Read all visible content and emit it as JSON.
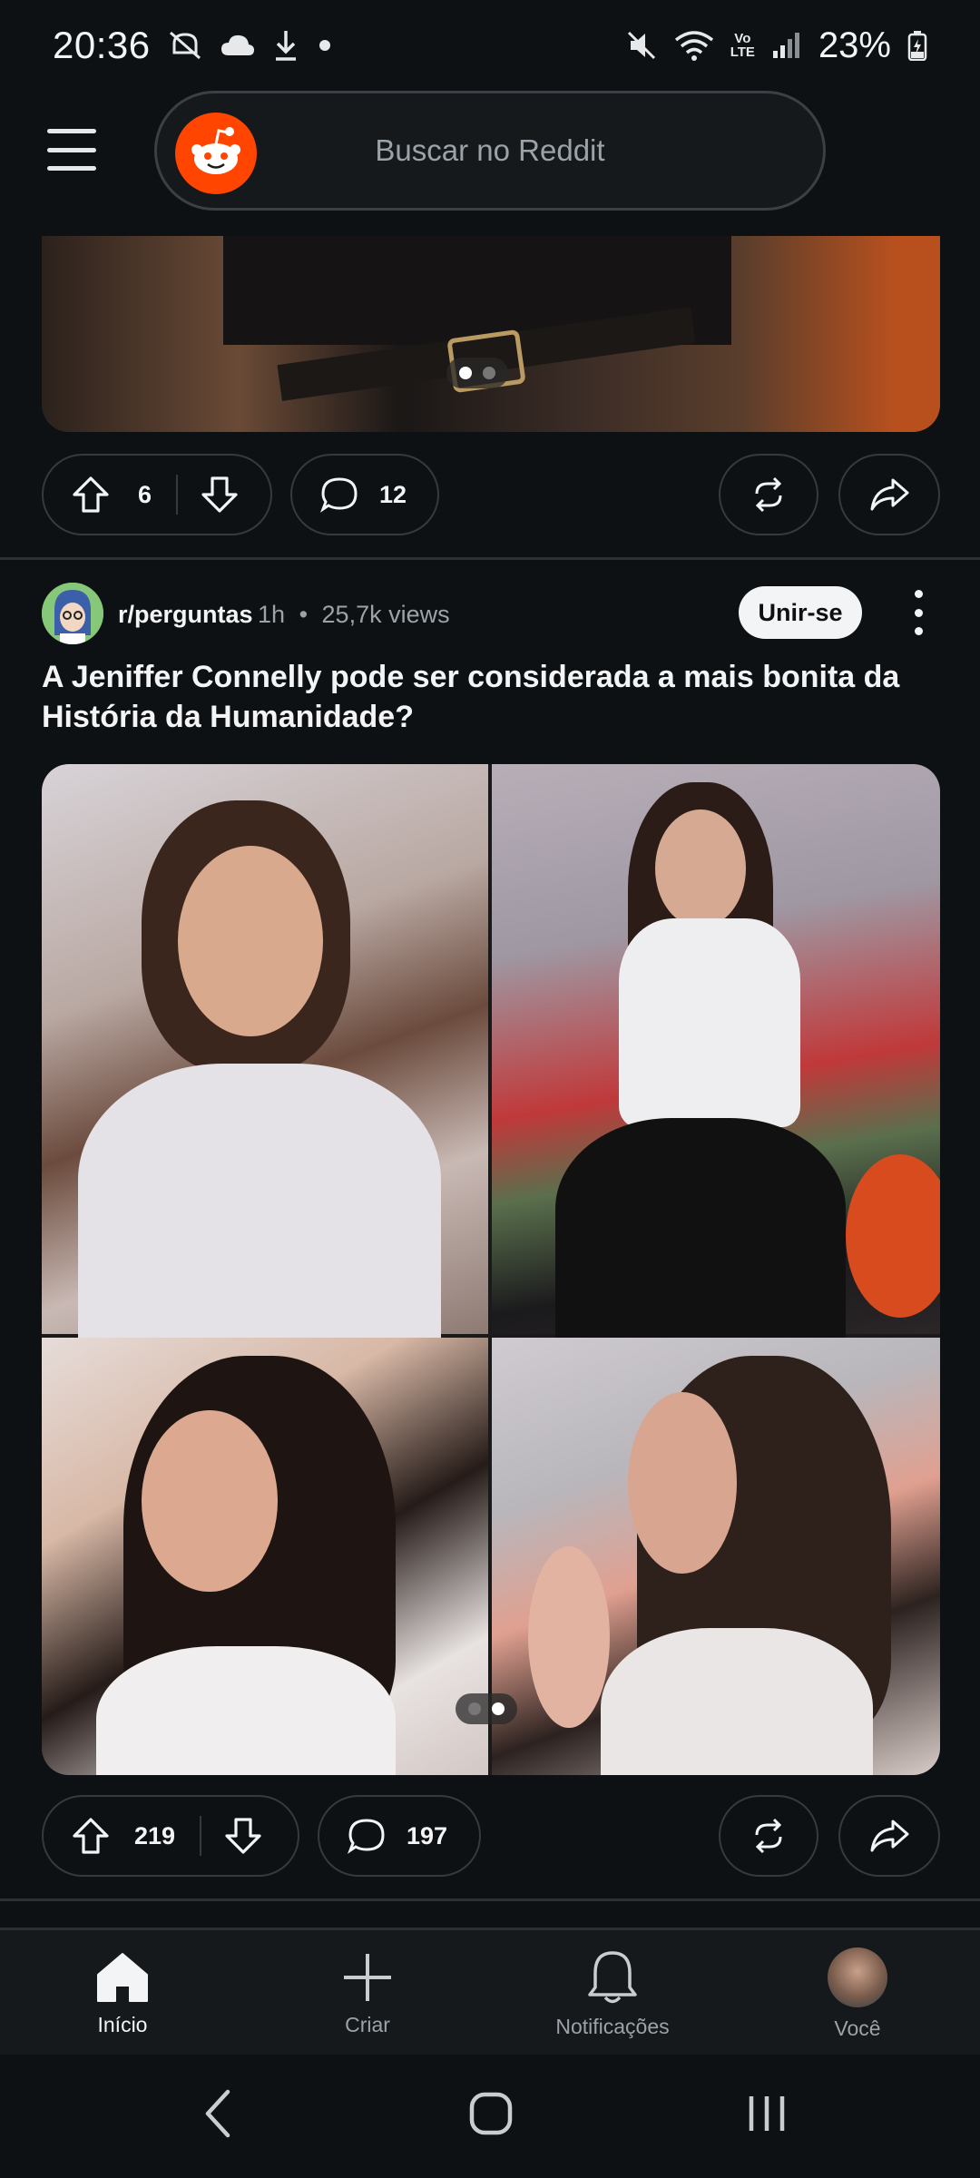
{
  "status_bar": {
    "time": "20:36",
    "left_icons": [
      "do-not-disturb-off-icon",
      "cloud-icon",
      "download-icon",
      "dot-icon"
    ],
    "right_icons": [
      "mute-icon",
      "wifi-icon",
      "volte-icon",
      "signal-icon"
    ],
    "volte_top": "Vo",
    "volte_bottom": "LTE",
    "battery": "23%"
  },
  "header": {
    "search_placeholder": "Buscar no Reddit"
  },
  "post1": {
    "upvotes": "6",
    "comments": "12",
    "gallery_pages": 2,
    "gallery_active_page": 1
  },
  "post2": {
    "subreddit": "r/perguntas",
    "time_ago": "1h",
    "separator": "•",
    "views": "25,7k views",
    "join_label": "Unir-se",
    "title": "A Jeniffer Connelly pode ser considerada a mais bonita da História da Humanidade?",
    "upvotes": "219",
    "comments": "197",
    "gallery_pages": 2,
    "gallery_active_page": 2
  },
  "bottom_nav": {
    "home": "Início",
    "create": "Criar",
    "notifications": "Notificações",
    "you": "Você"
  },
  "colors": {
    "background": "#0e1113",
    "reddit_orange": "#ff4500",
    "pill_border": "#343a3e",
    "muted_text": "#9ba3a8"
  }
}
